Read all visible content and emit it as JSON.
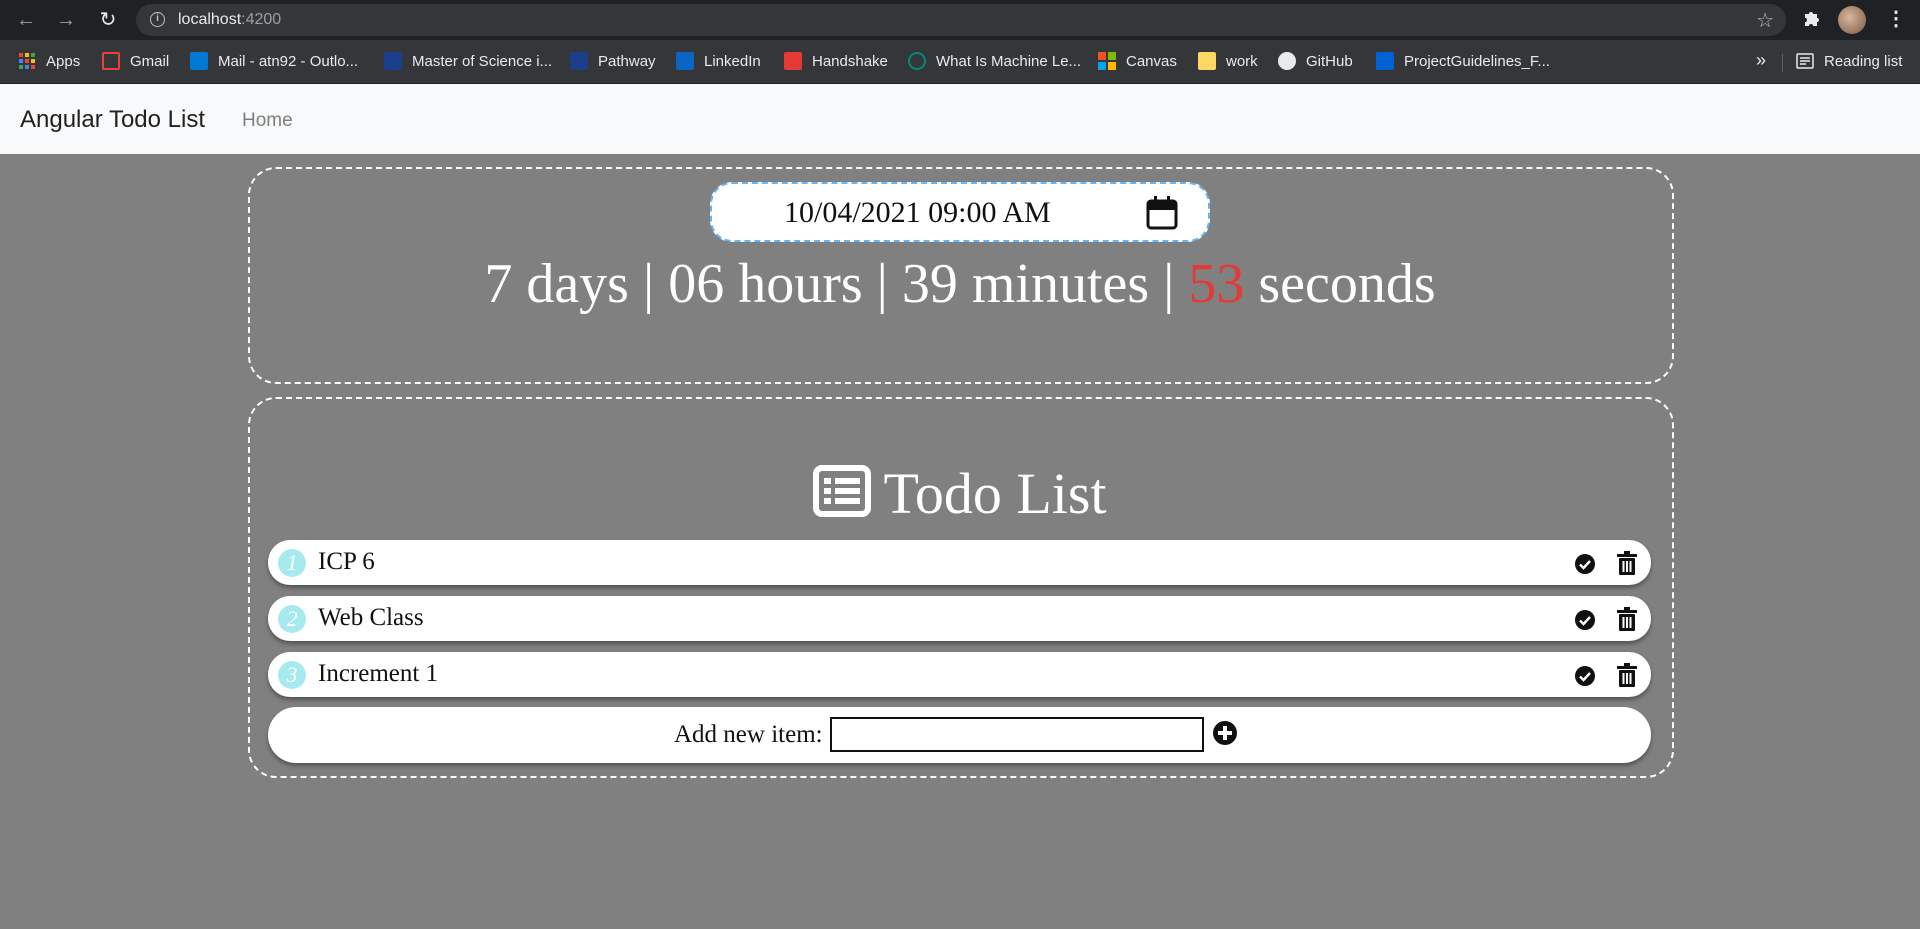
{
  "browser": {
    "url_host": "localhost",
    "url_port": ":4200",
    "bookmarks": [
      {
        "label": "Apps",
        "icon": "apps-grid-icon",
        "color": "#ea4335"
      },
      {
        "label": "Gmail",
        "icon": "gmail-icon",
        "color": "#ea4335"
      },
      {
        "label": "Mail - atn92 - Outlo...",
        "icon": "outlook-icon",
        "color": "#0078d4"
      },
      {
        "label": "Master of Science i...",
        "icon": "university-icon",
        "color": "#1a3e8c"
      },
      {
        "label": "Pathway",
        "icon": "university-icon",
        "color": "#1a3e8c"
      },
      {
        "label": "LinkedIn",
        "icon": "linkedin-icon",
        "color": "#0a66c2"
      },
      {
        "label": "Handshake",
        "icon": "handshake-icon",
        "color": "#e53935"
      },
      {
        "label": "What Is Machine Le...",
        "icon": "eye-icon",
        "color": "#00897b"
      },
      {
        "label": "Canvas",
        "icon": "microsoft-icon",
        "color": "#f25022"
      },
      {
        "label": "work",
        "icon": "folder-icon",
        "color": "#fdd663"
      },
      {
        "label": "GitHub",
        "icon": "github-icon",
        "color": "#e8eaed"
      },
      {
        "label": "ProjectGuidelines_F...",
        "icon": "box-icon",
        "color": "#0061d5"
      }
    ],
    "reading_list": "Reading list"
  },
  "app": {
    "brand": "Angular Todo List",
    "home_link": "Home"
  },
  "countdown": {
    "date_value": "10/04/2021 09:00 AM",
    "days_text": "7 days | 06 hours | 39 minutes | ",
    "seconds_value": "53",
    "seconds_label": " seconds",
    "seconds_color": "#e53935"
  },
  "todo": {
    "title": "Todo List",
    "items": [
      {
        "number": "1",
        "text": "ICP 6"
      },
      {
        "number": "2",
        "text": "Web Class"
      },
      {
        "number": "3",
        "text": "Increment 1"
      }
    ],
    "add_label": "Add new item:",
    "add_input_value": ""
  }
}
